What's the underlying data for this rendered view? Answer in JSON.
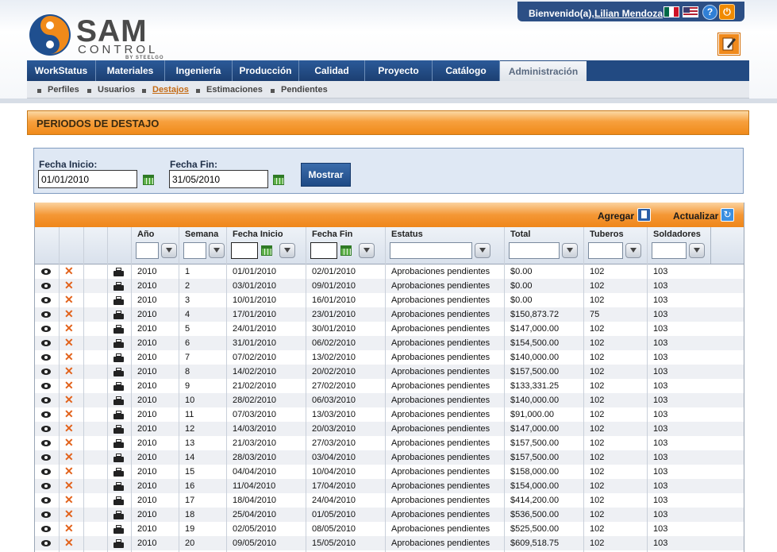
{
  "header": {
    "welcome": "Bienvenido(a),",
    "user": "Lilian Mendoza",
    "logo_main": "SAM",
    "logo_sub": "CONTROL",
    "logo_by": "BY STEELGO",
    "help": "?",
    "power": "⏻"
  },
  "nav": {
    "tabs": [
      "WorkStatus",
      "Materiales",
      "Ingeniería",
      "Producción",
      "Calidad",
      "Proyecto",
      "Catálogo",
      "Administración"
    ],
    "active_tab": "Administración",
    "subitems": [
      "Perfiles",
      "Usuarios",
      "Destajos",
      "Estimaciones",
      "Pendientes"
    ],
    "active_subitem": "Destajos"
  },
  "section": {
    "title": "PERIODOS DE DESTAJO"
  },
  "filter": {
    "start_label": "Fecha Inicio:",
    "start_value": "01/01/2010",
    "end_label": "Fecha Fin:",
    "end_value": "31/05/2010",
    "show_button": "Mostrar"
  },
  "grid": {
    "add_label": "Agregar",
    "refresh_label": "Actualizar",
    "columns": [
      "Año",
      "Semana",
      "Fecha Inicio",
      "Fecha Fin",
      "Estatus",
      "Total",
      "Tuberos",
      "Soldadores"
    ],
    "rows": [
      [
        "2010",
        "1",
        "01/01/2010",
        "02/01/2010",
        "Aprobaciones pendientes",
        "$0.00",
        "102",
        "103"
      ],
      [
        "2010",
        "2",
        "03/01/2010",
        "09/01/2010",
        "Aprobaciones pendientes",
        "$0.00",
        "102",
        "103"
      ],
      [
        "2010",
        "3",
        "10/01/2010",
        "16/01/2010",
        "Aprobaciones pendientes",
        "$0.00",
        "102",
        "103"
      ],
      [
        "2010",
        "4",
        "17/01/2010",
        "23/01/2010",
        "Aprobaciones pendientes",
        "$150,873.72",
        "75",
        "103"
      ],
      [
        "2010",
        "5",
        "24/01/2010",
        "30/01/2010",
        "Aprobaciones pendientes",
        "$147,000.00",
        "102",
        "103"
      ],
      [
        "2010",
        "6",
        "31/01/2010",
        "06/02/2010",
        "Aprobaciones pendientes",
        "$154,500.00",
        "102",
        "103"
      ],
      [
        "2010",
        "7",
        "07/02/2010",
        "13/02/2010",
        "Aprobaciones pendientes",
        "$140,000.00",
        "102",
        "103"
      ],
      [
        "2010",
        "8",
        "14/02/2010",
        "20/02/2010",
        "Aprobaciones pendientes",
        "$157,500.00",
        "102",
        "103"
      ],
      [
        "2010",
        "9",
        "21/02/2010",
        "27/02/2010",
        "Aprobaciones pendientes",
        "$133,331.25",
        "102",
        "103"
      ],
      [
        "2010",
        "10",
        "28/02/2010",
        "06/03/2010",
        "Aprobaciones pendientes",
        "$140,000.00",
        "102",
        "103"
      ],
      [
        "2010",
        "11",
        "07/03/2010",
        "13/03/2010",
        "Aprobaciones pendientes",
        "$91,000.00",
        "102",
        "103"
      ],
      [
        "2010",
        "12",
        "14/03/2010",
        "20/03/2010",
        "Aprobaciones pendientes",
        "$147,000.00",
        "102",
        "103"
      ],
      [
        "2010",
        "13",
        "21/03/2010",
        "27/03/2010",
        "Aprobaciones pendientes",
        "$157,500.00",
        "102",
        "103"
      ],
      [
        "2010",
        "14",
        "28/03/2010",
        "03/04/2010",
        "Aprobaciones pendientes",
        "$157,500.00",
        "102",
        "103"
      ],
      [
        "2010",
        "15",
        "04/04/2010",
        "10/04/2010",
        "Aprobaciones pendientes",
        "$158,000.00",
        "102",
        "103"
      ],
      [
        "2010",
        "16",
        "11/04/2010",
        "17/04/2010",
        "Aprobaciones pendientes",
        "$154,000.00",
        "102",
        "103"
      ],
      [
        "2010",
        "17",
        "18/04/2010",
        "24/04/2010",
        "Aprobaciones pendientes",
        "$414,200.00",
        "102",
        "103"
      ],
      [
        "2010",
        "18",
        "25/04/2010",
        "01/05/2010",
        "Aprobaciones pendientes",
        "$536,500.00",
        "102",
        "103"
      ],
      [
        "2010",
        "19",
        "02/05/2010",
        "08/05/2010",
        "Aprobaciones pendientes",
        "$525,500.00",
        "102",
        "103"
      ],
      [
        "2010",
        "20",
        "09/05/2010",
        "15/05/2010",
        "Aprobaciones pendientes",
        "$609,518.75",
        "102",
        "103"
      ]
    ]
  },
  "colors": {
    "nav": "#224a82",
    "accent_orange": "#f08a1a",
    "link_active": "#c46b15"
  }
}
